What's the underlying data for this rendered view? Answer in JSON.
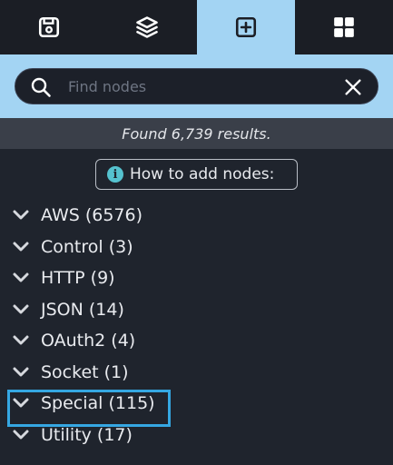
{
  "tabs": [
    {
      "id": "save",
      "icon": "save-icon",
      "active": false
    },
    {
      "id": "layers",
      "icon": "layers-icon",
      "active": false
    },
    {
      "id": "add",
      "icon": "plus-square-icon",
      "active": true
    },
    {
      "id": "grid",
      "icon": "grid-icon",
      "active": false
    }
  ],
  "search": {
    "placeholder": "Find nodes",
    "value": ""
  },
  "results": {
    "text": "Found 6,739 results."
  },
  "howto": {
    "label": "How to add nodes:",
    "icon": "info-icon"
  },
  "categories": [
    {
      "label": "AWS (6576)"
    },
    {
      "label": "Control (3)"
    },
    {
      "label": "HTTP (9)"
    },
    {
      "label": "JSON (14)"
    },
    {
      "label": "OAuth2 (4)"
    },
    {
      "label": "Socket (1)"
    },
    {
      "label": "Special (115)",
      "highlighted": true
    },
    {
      "label": "Utility (17)"
    }
  ],
  "colors": {
    "background": "#1f242d",
    "accent": "#a3d4f3",
    "highlight_border": "#35a7e2",
    "info": "#55c2cf"
  }
}
